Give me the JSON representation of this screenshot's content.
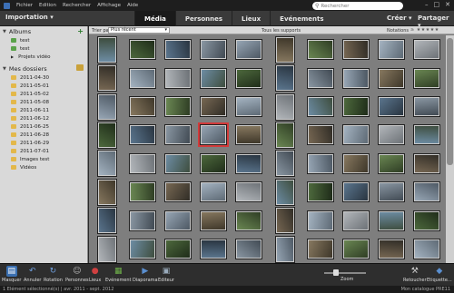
{
  "menubar": {
    "items": [
      "Fichier",
      "Edition",
      "Rechercher",
      "Affichage",
      "Aide"
    ],
    "search_placeholder": "Rechercher"
  },
  "topbar": {
    "import_label": "Importation",
    "tabs": [
      "Média",
      "Personnes",
      "Lieux",
      "Evénements"
    ],
    "creer_label": "Créer",
    "partager_label": "Partager"
  },
  "sidebar": {
    "albums_title": "Albums",
    "albums": [
      "test",
      "test",
      "Projets vidéo"
    ],
    "dossiers_title": "Mes dossiers",
    "dossiers": [
      "2011-04-30",
      "2011-05-01",
      "2011-05-02",
      "2011-05-08",
      "2011-06-11",
      "2011-06-12",
      "2011-06-25",
      "2011-06-28",
      "2011-06-29",
      "2011-07-01",
      "Images test",
      "Vidéos"
    ]
  },
  "content": {
    "trier_label": "Trier par:",
    "sort_value": "Plus récent",
    "sources_label": "Tous les supports",
    "notations_label": "Notations",
    "stars": "≥ ★★★★★"
  },
  "bottombar": {
    "tools": [
      "Masquer",
      "Annuler",
      "Rotation",
      "Personnes",
      "Lieux",
      "Evénement",
      "Diaporama",
      "Editeur",
      "Retoucher",
      "Etiquette..."
    ],
    "zoom_label": "Zoom"
  },
  "status": {
    "left": "1 Elément sélectionné(s)  |  avr. 2011 - sept. 2012",
    "right": "Mon catalogue PRE11"
  },
  "colors": {
    "accent": "#3c6fb5",
    "folder": "#e3b84a",
    "album": "#5aa24a",
    "grid_bg": "#7e7e7e"
  }
}
